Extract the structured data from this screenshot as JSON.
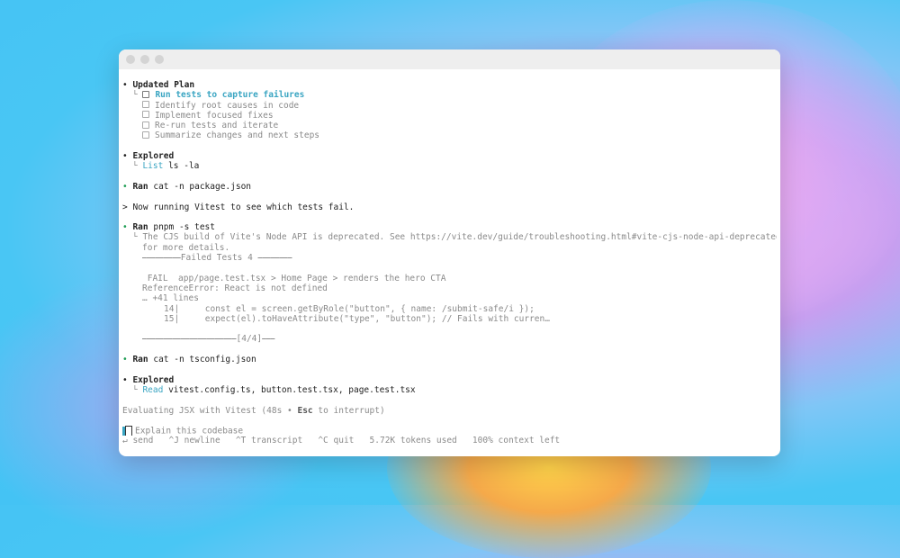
{
  "plan": {
    "header": "Updated Plan",
    "items": [
      {
        "label": "Run tests to capture failures",
        "active": true
      },
      {
        "label": "Identify root causes in code",
        "active": false
      },
      {
        "label": "Implement focused fixes",
        "active": false
      },
      {
        "label": "Re-run tests and iterate",
        "active": false
      },
      {
        "label": "Summarize changes and next steps",
        "active": false
      }
    ]
  },
  "explored1": {
    "header": "Explored",
    "action": "List",
    "detail": "ls -la"
  },
  "ran1": {
    "label": "Ran",
    "command": "cat -n package.json"
  },
  "message": "> Now running Vitest to see which tests fail.",
  "ran2": {
    "label": "Ran",
    "command": "pnpm -s test",
    "output": [
      "The CJS build of Vite's Node API is deprecated. See https://vite.dev/guide/troubleshooting.html#vite-cjs-node-api-deprecated",
      "for more details.",
      "⎯⎯⎯⎯⎯⎯⎯⎯⎯Failed Tests 4 ⎯⎯⎯⎯⎯⎯⎯⎯",
      "",
      " FAIL  app/page.test.tsx > Home Page > renders the hero CTA",
      "ReferenceError: React is not defined",
      "… +41 lines",
      "14|     const el = screen.getByRole(\"button\", { name: /submit-safe/i });",
      "15|     expect(el).toHaveAttribute(\"type\", \"button\"); // Fails with curren…",
      "",
      "⎯⎯⎯⎯⎯⎯⎯⎯⎯⎯⎯⎯⎯⎯⎯⎯⎯⎯⎯⎯⎯⎯[4/4]⎯⎯⎯"
    ]
  },
  "ran3": {
    "label": "Ran",
    "command": "cat -n tsconfig.json"
  },
  "explored2": {
    "header": "Explored",
    "action": "Read",
    "detail": "vitest.config.ts, button.test.tsx, page.test.tsx"
  },
  "status": {
    "prefix": "Evaluating JSX with Vitest (48s • ",
    "key": "Esc",
    "suffix": " to interrupt)"
  },
  "input": {
    "placeholder": "Explain this codebase"
  },
  "footer": "↵ send   ^J newline   ^T transcript   ^C quit   5.72K tokens used   100% context left",
  "colors": {
    "accent": "#3aa5c2",
    "success": "#1f9d55"
  }
}
